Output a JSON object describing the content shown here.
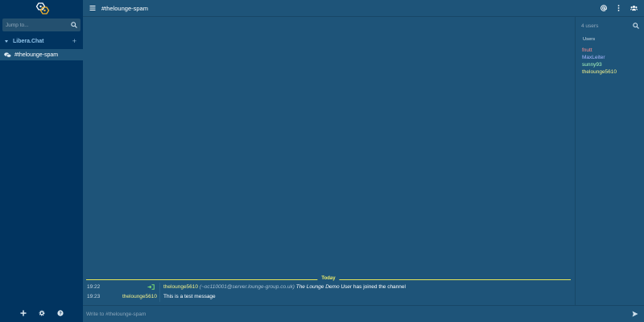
{
  "app": {
    "logo_icon": "thelounge-logo-icon"
  },
  "sidebar": {
    "search": {
      "placeholder": "Jump to..."
    },
    "network": {
      "name": "Libera.Chat"
    },
    "channels": [
      {
        "name": "#thelounge-spam",
        "active": true
      }
    ],
    "footer_icons": [
      "plus-icon",
      "gear-icon",
      "help-icon"
    ]
  },
  "header": {
    "channel_title": "#thelounge-spam",
    "icons": [
      "menu-icon",
      "mentions-icon",
      "more-icon",
      "users-icon"
    ]
  },
  "chat": {
    "date_marker": "Today",
    "messages": [
      {
        "time": "19:22",
        "type": "join",
        "nick": "thelounge5610",
        "hostmask": "(~oc110001@server.lounge-group.co.uk)",
        "realname": "The Lounge Demo User",
        "text": "has joined the channel"
      },
      {
        "time": "19:23",
        "type": "message",
        "nick": "thelounge5610",
        "text": "This is a test message"
      }
    ]
  },
  "input": {
    "placeholder": "Write to #thelounge-spam"
  },
  "userlist": {
    "count": "4 users",
    "heading": "Users",
    "users": [
      {
        "nick": "fnutt",
        "color": "#ff8f8f"
      },
      {
        "nick": "MaxLeiter",
        "color": "#a9b8ff"
      },
      {
        "nick": "sunny93",
        "color": "#a9f7bd"
      },
      {
        "nick": "thelounge5610",
        "color": "#f1f08b"
      }
    ]
  },
  "colors": {
    "background": "#1e5479",
    "sidebar": "#013460",
    "accent_blue": "#8fc3e9",
    "date_marker": "#eded6b",
    "join_arrow": "#7bdc74"
  }
}
